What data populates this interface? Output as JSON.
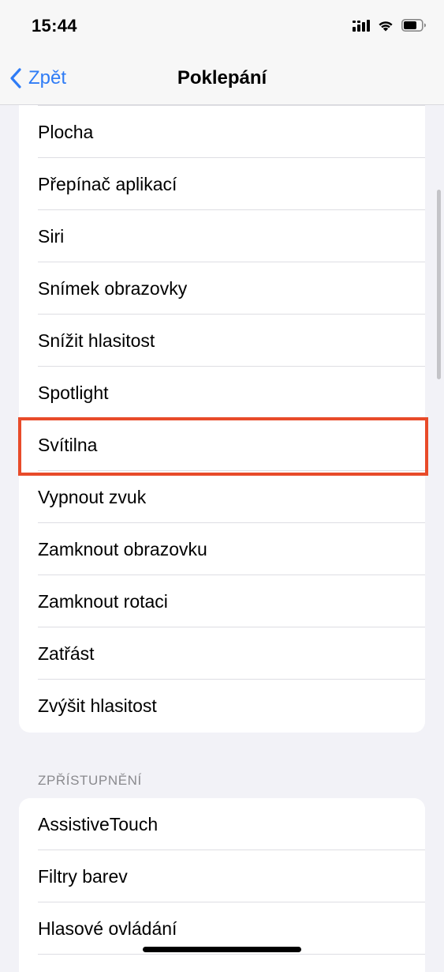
{
  "status_bar": {
    "time": "15:44",
    "icons": [
      "cellular-signal-icon",
      "wifi-icon",
      "battery-icon"
    ]
  },
  "nav": {
    "back_label": "Zpět",
    "title": "Poklepání"
  },
  "actions": {
    "items": [
      {
        "label": "Plocha"
      },
      {
        "label": "Přepínač aplikací"
      },
      {
        "label": "Siri"
      },
      {
        "label": "Snímek obrazovky"
      },
      {
        "label": "Snížit hlasitost"
      },
      {
        "label": "Spotlight"
      },
      {
        "label": "Svítilna",
        "highlighted": true
      },
      {
        "label": "Vypnout zvuk"
      },
      {
        "label": "Zamknout obrazovku"
      },
      {
        "label": "Zamknout rotaci"
      },
      {
        "label": "Zatřást"
      },
      {
        "label": "Zvýšit hlasitost"
      }
    ]
  },
  "accessibility": {
    "header": "ZPŘÍSTUPNĚNÍ",
    "items": [
      {
        "label": "AssistiveTouch"
      },
      {
        "label": "Filtry barev"
      },
      {
        "label": "Hlasové ovládání"
      }
    ]
  },
  "colors": {
    "accent": "#2f7cf6",
    "highlight": "#e84b2a",
    "background": "#f2f2f7"
  }
}
